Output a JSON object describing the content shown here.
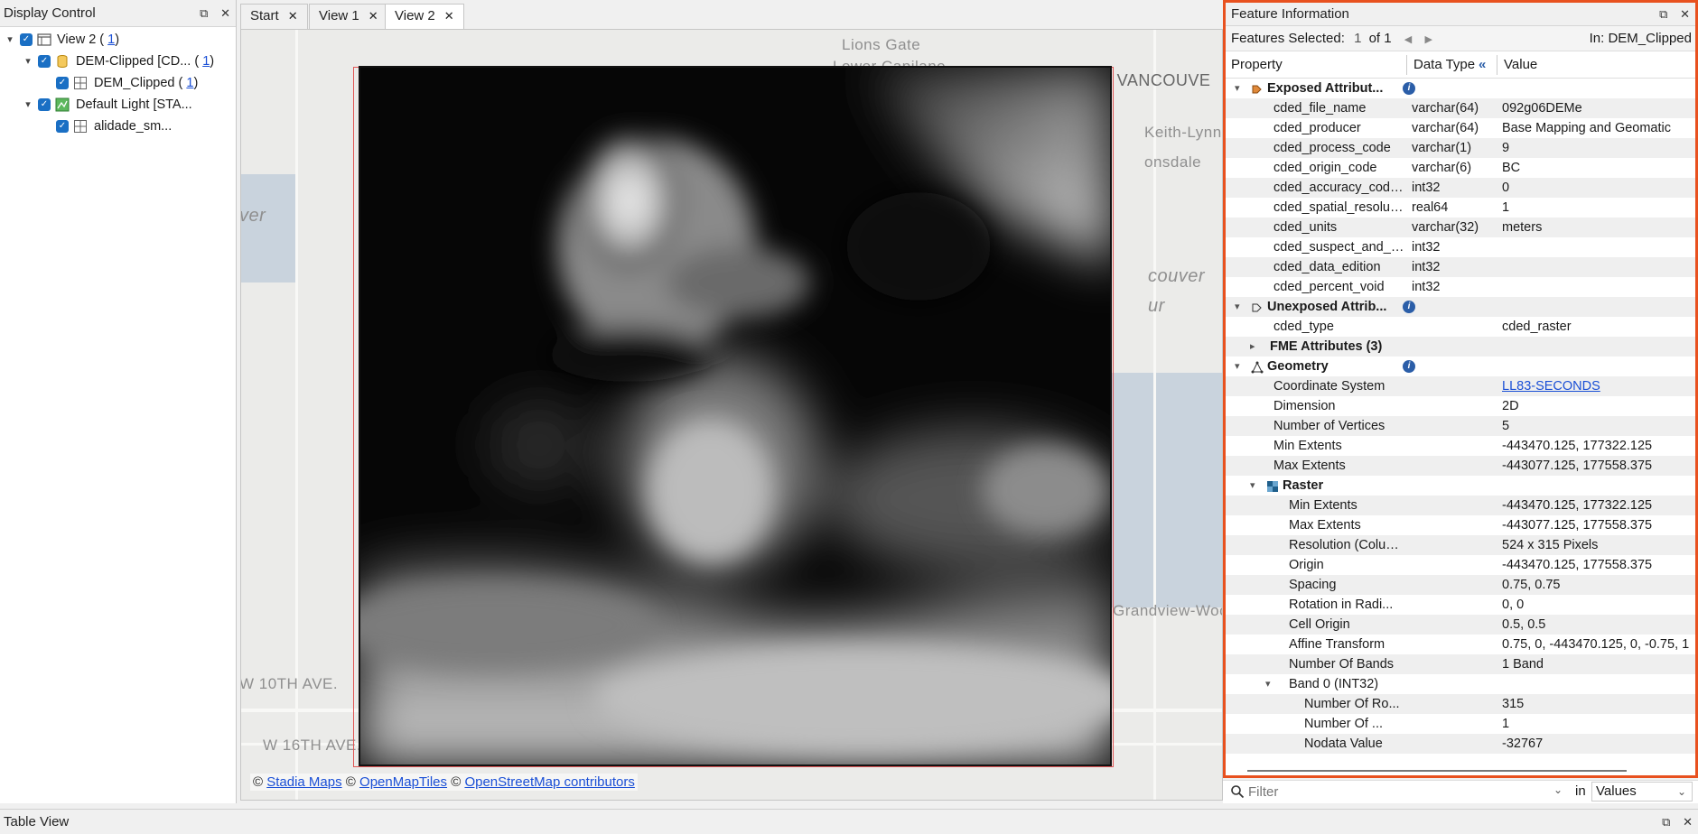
{
  "display_control": {
    "title": "Display Control",
    "tree": [
      {
        "label": "View 2 (",
        "count": "1",
        "suffix": ")"
      },
      {
        "label": "DEM-Clipped [CD... (",
        "count": "1",
        "suffix": ")"
      },
      {
        "label": "DEM_Clipped (",
        "count": "1",
        "suffix": ")"
      },
      {
        "label": "Default Light [STA..."
      },
      {
        "label": "alidade_sm..."
      }
    ]
  },
  "tabs": [
    "Start",
    "View 1",
    "View 2"
  ],
  "map": {
    "labels": [
      "Lions Gate",
      "Lower Capilano",
      "NORTH VANCOUVE",
      "Keith-Lynn",
      "onsdale",
      "couver",
      "ur",
      "Grandview-Wood",
      "W 10TH AVE.",
      "W 16TH AVE.",
      "ver"
    ],
    "attribution": {
      "sep": "©",
      "stadia": "Stadia Maps",
      "omt": "OpenMapTiles",
      "osm": "OpenStreetMap contributors"
    }
  },
  "feature_info": {
    "title": "Feature Information",
    "features_selected_label": "Features Selected:",
    "selected": "1",
    "of": "of 1",
    "in_label": "In:",
    "in_value": "DEM_Clipped",
    "headers": {
      "property": "Property",
      "type": "Data Type",
      "value": "Value"
    },
    "rows": [
      {
        "p": "Exposed Attribut...",
        "t": "",
        "v": "",
        "group": true,
        "indent": 0,
        "exp": "open",
        "icon": "exposed-attributes-icon",
        "info": true
      },
      {
        "p": "cded_file_name",
        "t": "varchar(64)",
        "v": "092g06DEMe",
        "indent": 1
      },
      {
        "p": "cded_producer",
        "t": "varchar(64)",
        "v": "Base Mapping and Geomatic",
        "indent": 1
      },
      {
        "p": "cded_process_code",
        "t": "varchar(1)",
        "v": "9",
        "indent": 1
      },
      {
        "p": "cded_origin_code",
        "t": "varchar(6)",
        "v": "BC",
        "indent": 1
      },
      {
        "p": "cded_accuracy_code_...",
        "t": "int32",
        "v": "0",
        "indent": 1
      },
      {
        "p": "cded_spatial_resoluti...",
        "t": "real64",
        "v": "1",
        "indent": 1
      },
      {
        "p": "cded_units",
        "t": "varchar(32)",
        "v": "meters",
        "indent": 1
      },
      {
        "p": "cded_suspect_and_voi...",
        "t": "int32",
        "v": "",
        "indent": 1
      },
      {
        "p": "cded_data_edition",
        "t": "int32",
        "v": "",
        "indent": 1
      },
      {
        "p": "cded_percent_void",
        "t": "int32",
        "v": "",
        "indent": 1
      },
      {
        "p": "Unexposed Attrib...",
        "t": "",
        "v": "",
        "group": true,
        "indent": 0,
        "exp": "open",
        "icon": "unexposed-attributes-icon",
        "info": true
      },
      {
        "p": "cded_type",
        "t": "",
        "v": "cded_raster",
        "indent": 1
      },
      {
        "p": "FME Attributes (3)",
        "t": "",
        "v": "",
        "group": true,
        "indent": 1,
        "exp": "closed"
      },
      {
        "p": "Geometry",
        "t": "",
        "v": "",
        "group": true,
        "indent": 0,
        "exp": "open",
        "icon": "geometry-icon",
        "info": true
      },
      {
        "p": "Coordinate System",
        "t": "",
        "v": "LL83-SECONDS",
        "indent": 1,
        "link": true
      },
      {
        "p": "Dimension",
        "t": "",
        "v": "2D",
        "indent": 1
      },
      {
        "p": "Number of Vertices",
        "t": "",
        "v": "5",
        "indent": 1
      },
      {
        "p": "Min Extents",
        "t": "",
        "v": "-443470.125, 177322.125",
        "indent": 1
      },
      {
        "p": "Max Extents",
        "t": "",
        "v": "-443077.125, 177558.375",
        "indent": 1
      },
      {
        "p": "Raster",
        "t": "",
        "v": "",
        "group": true,
        "indent": 1,
        "exp": "open",
        "icon": "raster-icon"
      },
      {
        "p": "Min Extents",
        "t": "",
        "v": "-443470.125, 177322.125",
        "indent": 2
      },
      {
        "p": "Max Extents",
        "t": "",
        "v": "-443077.125, 177558.375",
        "indent": 2
      },
      {
        "p": "Resolution (Colum...",
        "t": "",
        "v": "524 x 315 Pixels",
        "indent": 2
      },
      {
        "p": "Origin",
        "t": "",
        "v": "-443470.125, 177558.375",
        "indent": 2
      },
      {
        "p": "Spacing",
        "t": "",
        "v": "0.75, 0.75",
        "indent": 2
      },
      {
        "p": "Rotation in Radi...",
        "t": "",
        "v": "0, 0",
        "indent": 2
      },
      {
        "p": "Cell Origin",
        "t": "",
        "v": "0.5, 0.5",
        "indent": 2
      },
      {
        "p": "Affine Transform",
        "t": "",
        "v": "0.75, 0, -443470.125, 0, -0.75, 1",
        "indent": 2
      },
      {
        "p": "Number Of Bands",
        "t": "",
        "v": "1 Band",
        "indent": 2
      },
      {
        "p": "Band 0 (INT32)",
        "t": "",
        "v": "",
        "indent": 2,
        "exp": "open"
      },
      {
        "p": "Number Of Ro...",
        "t": "",
        "v": "315",
        "indent": 3
      },
      {
        "p": "Number Of ...",
        "t": "",
        "v": "1",
        "indent": 3
      },
      {
        "p": "Nodata Value",
        "t": "",
        "v": "-32767",
        "indent": 3
      }
    ],
    "filter_placeholder": "Filter",
    "filter_in": "in",
    "filter_scope": "Values"
  },
  "table_view": {
    "title": "Table View"
  }
}
